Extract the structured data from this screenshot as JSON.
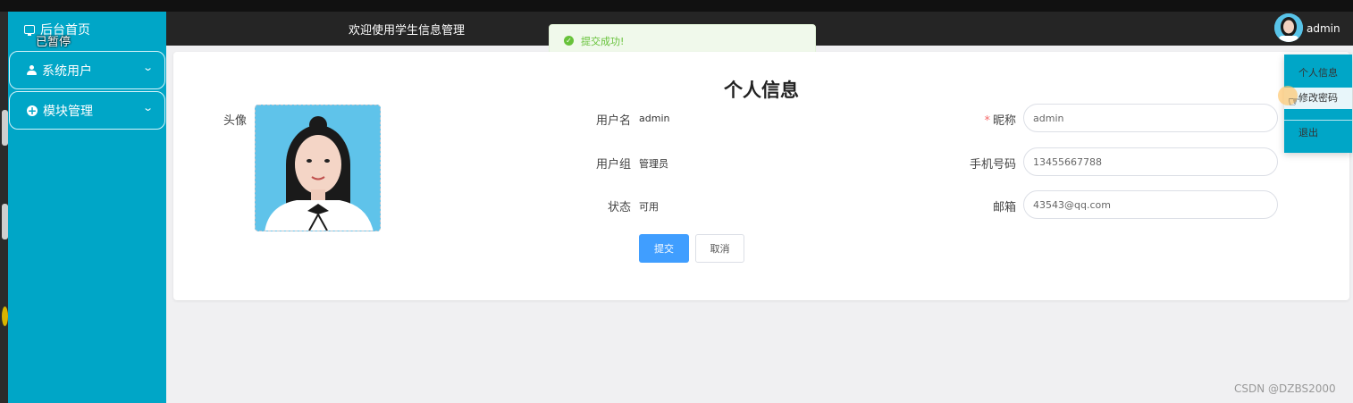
{
  "sidebar": {
    "home_label": "后台首页",
    "paused_overlay": "已暂停",
    "items": [
      {
        "label": "系统用户",
        "icon": "user-icon"
      },
      {
        "label": "模块管理",
        "icon": "plus-circle-icon"
      }
    ],
    "bg_color": "#00a6c7"
  },
  "header": {
    "title": "欢迎使用学生信息管理",
    "username": "admin"
  },
  "toast": {
    "message": "提交成功!",
    "color": "#67c23a"
  },
  "profile": {
    "title": "个人信息",
    "avatar_label": "头像",
    "username_label": "用户名",
    "username_value": "admin",
    "group_label": "用户组",
    "group_value": "管理员",
    "status_label": "状态",
    "status_value": "可用",
    "nickname_label": "昵称",
    "nickname_value": "admin",
    "phone_label": "手机号码",
    "phone_value": "13455667788",
    "email_label": "邮箱",
    "email_value": "43543@qq.com",
    "submit_label": "提交",
    "cancel_label": "取消"
  },
  "user_menu": {
    "items": [
      "个人信息",
      "修改密码",
      "退出"
    ],
    "hovered": "修改密码"
  },
  "watermark": "CSDN @DZBS2000"
}
